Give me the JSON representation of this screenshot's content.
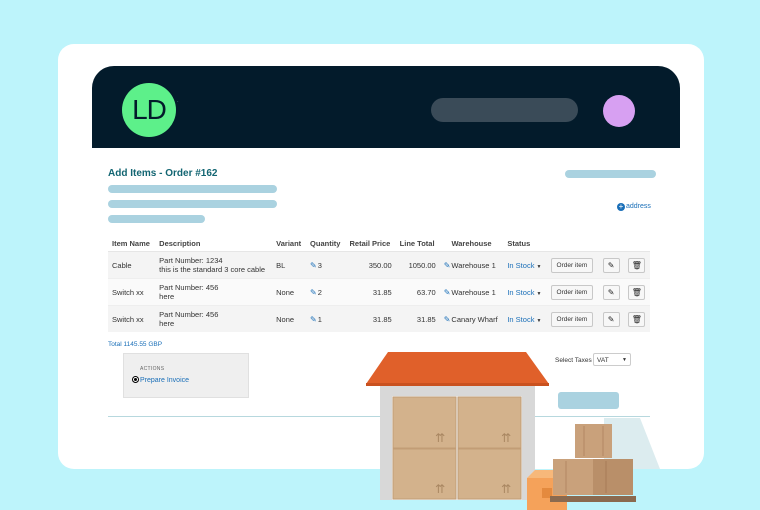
{
  "header": {
    "logo_text": "LD",
    "logo_mark": "·"
  },
  "page": {
    "title": "Add Items - Order #162",
    "address_link": "address"
  },
  "table": {
    "columns": [
      "Item Name",
      "Description",
      "Variant",
      "Quantity",
      "Retail Price",
      "Line Total",
      "Warehouse",
      "Status"
    ],
    "rows": [
      {
        "item": "Cable",
        "desc1": "Part Number: 1234",
        "desc2": "this is the standard 3 core cable",
        "variant": "BL",
        "qty": "3",
        "price": "350.00",
        "total": "1050.00",
        "warehouse": "Warehouse 1",
        "status": "In Stock",
        "order_btn": "Order item"
      },
      {
        "item": "Switch xx",
        "desc1": "Part Number: 456",
        "desc2": "here",
        "variant": "None",
        "qty": "2",
        "price": "31.85",
        "total": "63.70",
        "warehouse": "Warehouse 1",
        "status": "In Stock",
        "order_btn": "Order item"
      },
      {
        "item": "Switch xx",
        "desc1": "Part Number: 456",
        "desc2": "here",
        "variant": "None",
        "qty": "1",
        "price": "31.85",
        "total": "31.85",
        "warehouse": "Canary Wharf",
        "status": "In Stock",
        "order_btn": "Order item"
      }
    ]
  },
  "summary": {
    "total": "Total 1145.55 GBP"
  },
  "actions": {
    "heading": "ACTIONS",
    "prepare": "Prepare Invoice"
  },
  "taxes": {
    "label": "Select Taxes",
    "value": "VAT"
  },
  "icons": {
    "edit": "edit-icon",
    "delete": "trash-icon",
    "add": "plus-circle-icon"
  },
  "colors": {
    "background": "#bdf4fb",
    "appbar": "#031b2b",
    "logo": "#5df08a",
    "avatar": "#d7a0f2",
    "accent": "#126572",
    "link": "#1a6fb8",
    "roof": "#e0602a"
  }
}
